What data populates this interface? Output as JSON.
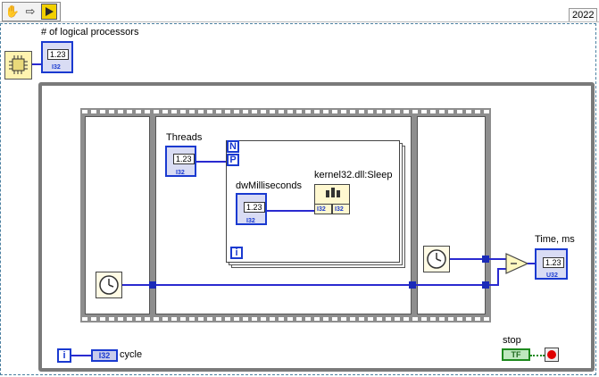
{
  "toolbar": {
    "run_tool_icon": "hand-icon",
    "step_icon": "arrow-right-icon",
    "highlight_icon": "highlight-execution-icon",
    "year": "2022"
  },
  "block_diagram": {
    "cpu_info_node_icon": "cpu-info-icon",
    "logical_processors_label": "# of logical processors",
    "logical_processors_value": "1.23",
    "logical_processors_type": "I32",
    "threads_label": "Threads",
    "threads_value": "1.23",
    "threads_type": "I32",
    "parallel_n": "N",
    "parallel_p": "P",
    "dw_label": "dwMilliseconds",
    "dw_value": "1.23",
    "dw_type": "I32",
    "dll_label": "kernel32.dll:Sleep",
    "dll_type_left": "I32",
    "dll_type_right": "I32",
    "for_loop_iteration": "i",
    "time_label": "Time, ms",
    "time_value": "1.23",
    "time_type": "U32",
    "while_iteration": "i",
    "cycle_label": "cycle",
    "cycle_type": "I32",
    "stop_label": "stop",
    "stop_value": "TF"
  },
  "colors": {
    "wire_int": "#2a2ad0",
    "loop_border": "#7a7a7a",
    "frame_film": "#8e8e8e",
    "boolean_green": "#1e8a1e",
    "stop_red": "#e00000"
  }
}
